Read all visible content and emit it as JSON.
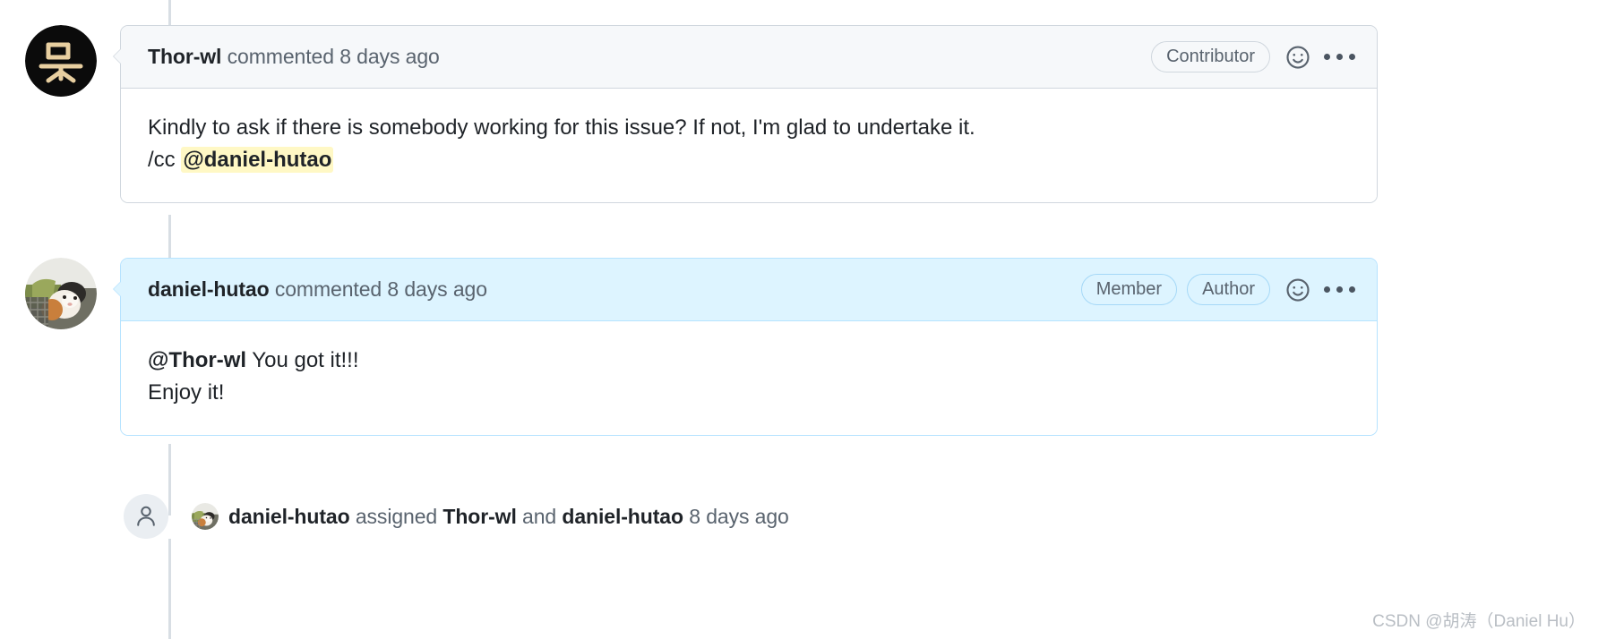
{
  "thread": {
    "comments": [
      {
        "author": "Thor-wl",
        "action_text": "commented 8 days ago",
        "badges": [
          "Contributor"
        ],
        "body_lines": [
          "Kindly to ask if there is somebody working for this issue? If not, I'm glad to undertake it.",
          "/cc "
        ],
        "mention": "@daniel-hutao",
        "avatar_alt": "Thor-wl avatar",
        "reaction_icon": "smiley-icon",
        "menu_icon": "kebab-menu-icon"
      },
      {
        "author": "daniel-hutao",
        "action_text": "commented 8 days ago",
        "badges": [
          "Member",
          "Author"
        ],
        "body_mention": "@Thor-wl",
        "body_line_1_rest": " You got it!!!",
        "body_line_2": "Enjoy it!",
        "avatar_alt": "daniel-hutao avatar",
        "reaction_icon": "smiley-icon",
        "menu_icon": "kebab-menu-icon"
      }
    ],
    "event": {
      "icon": "person-icon",
      "actor": "daniel-hutao",
      "verb": " assigned ",
      "assignee_1": "Thor-wl",
      "conjunction": " and ",
      "assignee_2": "daniel-hutao",
      "timestamp": " 8 days ago"
    }
  },
  "watermark": {
    "text": "CSDN @胡涛（Daniel Hu）"
  },
  "colors": {
    "author_comment_bg": "#ddf4ff",
    "author_comment_border": "#b6e3ff",
    "header_bg": "#f6f8fa",
    "border": "#d0d7de",
    "mention_highlight": "#fff8c5",
    "muted_text": "#59636e",
    "text": "#1f2328",
    "rail": "#d8dee4"
  }
}
